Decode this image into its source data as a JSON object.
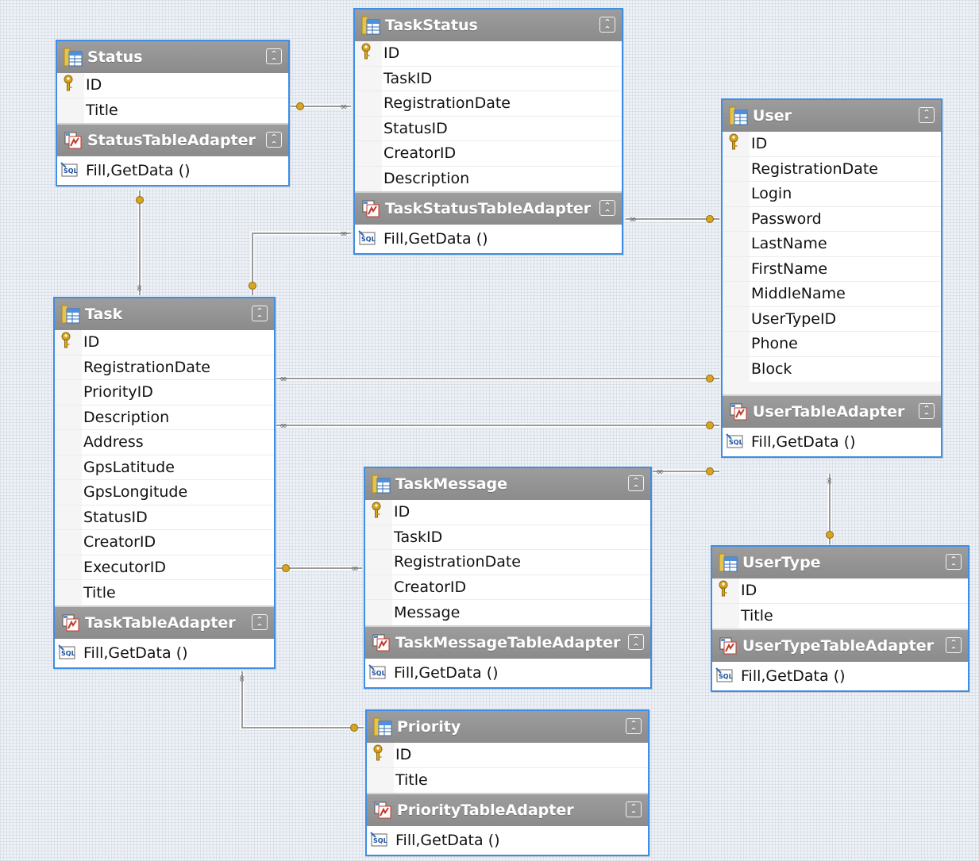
{
  "tables": [
    {
      "id": "status",
      "name": "Status",
      "columns": [
        {
          "name": "ID",
          "key": true
        },
        {
          "name": "Title"
        }
      ],
      "adapter": "StatusTableAdapter",
      "methods": "Fill,GetData ()"
    },
    {
      "id": "taskstatus",
      "name": "TaskStatus",
      "columns": [
        {
          "name": "ID",
          "key": true
        },
        {
          "name": "TaskID"
        },
        {
          "name": "RegistrationDate"
        },
        {
          "name": "StatusID"
        },
        {
          "name": "CreatorID"
        },
        {
          "name": "Description"
        }
      ],
      "adapter": "TaskStatusTableAdapter",
      "methods": "Fill,GetData ()"
    },
    {
      "id": "user",
      "name": "User",
      "columns": [
        {
          "name": "ID",
          "key": true
        },
        {
          "name": "RegistrationDate"
        },
        {
          "name": "Login"
        },
        {
          "name": "Password"
        },
        {
          "name": "LastName"
        },
        {
          "name": "FirstName"
        },
        {
          "name": "MiddleName"
        },
        {
          "name": "UserTypeID"
        },
        {
          "name": "Phone"
        },
        {
          "name": "Block"
        }
      ],
      "adapter": "UserTableAdapter",
      "methods": "Fill,GetData ()"
    },
    {
      "id": "task",
      "name": "Task",
      "columns": [
        {
          "name": "ID",
          "key": true
        },
        {
          "name": "RegistrationDate"
        },
        {
          "name": "PriorityID"
        },
        {
          "name": "Description"
        },
        {
          "name": "Address"
        },
        {
          "name": "GpsLatitude"
        },
        {
          "name": "GpsLongitude"
        },
        {
          "name": "StatusID"
        },
        {
          "name": "CreatorID"
        },
        {
          "name": "ExecutorID"
        },
        {
          "name": "Title"
        }
      ],
      "adapter": "TaskTableAdapter",
      "methods": "Fill,GetData ()"
    },
    {
      "id": "taskmessage",
      "name": "TaskMessage",
      "columns": [
        {
          "name": "ID",
          "key": true
        },
        {
          "name": "TaskID"
        },
        {
          "name": "RegistrationDate"
        },
        {
          "name": "CreatorID"
        },
        {
          "name": "Message"
        }
      ],
      "adapter": "TaskMessageTableAdapter",
      "methods": "Fill,GetData ()"
    },
    {
      "id": "usertype",
      "name": "UserType",
      "columns": [
        {
          "name": "ID",
          "key": true
        },
        {
          "name": "Title"
        }
      ],
      "adapter": "UserTypeTableAdapter",
      "methods": "Fill,GetData ()"
    },
    {
      "id": "priority",
      "name": "Priority",
      "columns": [
        {
          "name": "ID",
          "key": true
        },
        {
          "name": "Title"
        }
      ],
      "adapter": "PriorityTableAdapter",
      "methods": "Fill,GetData ()"
    }
  ],
  "relations": [
    {
      "one": "status",
      "many": "taskstatus"
    },
    {
      "one": "status",
      "many": "task"
    },
    {
      "one": "task",
      "many": "taskstatus"
    },
    {
      "one": "user",
      "many": "taskstatus"
    },
    {
      "one": "user",
      "many": "task",
      "via": "CreatorID"
    },
    {
      "one": "user",
      "many": "task",
      "via": "ExecutorID"
    },
    {
      "one": "user",
      "many": "taskmessage"
    },
    {
      "one": "task",
      "many": "taskmessage"
    },
    {
      "one": "usertype",
      "many": "user"
    },
    {
      "one": "priority",
      "many": "task"
    }
  ],
  "colors": {
    "header": "#959595",
    "border": "#3c8ee6",
    "key": "#d9a520",
    "line": "#9a9a9a",
    "canvas": "#eef1f6"
  },
  "icons": {
    "table": "table-icon",
    "adapter": "table-adapter-icon",
    "key": "primary-key-icon",
    "query": "sql-query-icon",
    "collapse": "collapse-chevron-icon"
  }
}
